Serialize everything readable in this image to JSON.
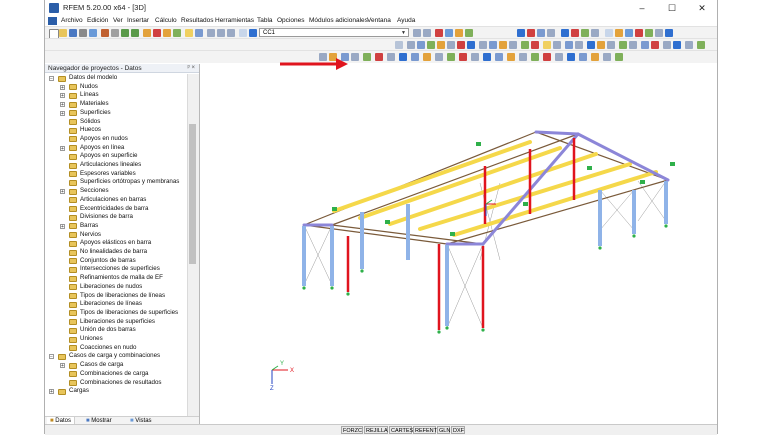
{
  "window": {
    "title": "RFEM 5.20.00 x64 - [3D]",
    "minimize": "–",
    "maximize": "☐",
    "close": "✕"
  },
  "menu": [
    "Archivo",
    "Edición",
    "Ver",
    "Insertar",
    "Cálculo",
    "Resultados",
    "Herramientas",
    "Tabla",
    "Opciones",
    "Módulos adicionales",
    "Ventana",
    "Ayuda"
  ],
  "toolbar": {
    "load_case": "CC1"
  },
  "navigator": {
    "title": "Navegador de proyectos - Datos",
    "pin": "ᵖ ×",
    "items": [
      {
        "label": "Datos del modelo",
        "level": 0,
        "expander": "−"
      },
      {
        "label": "Nudos",
        "level": 1,
        "expander": "+"
      },
      {
        "label": "Líneas",
        "level": 1,
        "expander": "+"
      },
      {
        "label": "Materiales",
        "level": 1,
        "expander": "+"
      },
      {
        "label": "Superficies",
        "level": 1,
        "expander": "+"
      },
      {
        "label": "Sólidos",
        "level": 1,
        "expander": ""
      },
      {
        "label": "Huecos",
        "level": 1,
        "expander": ""
      },
      {
        "label": "Apoyos en nudos",
        "level": 1,
        "expander": ""
      },
      {
        "label": "Apoyos en línea",
        "level": 1,
        "expander": "+"
      },
      {
        "label": "Apoyos en superficie",
        "level": 1,
        "expander": ""
      },
      {
        "label": "Articulaciones lineales",
        "level": 1,
        "expander": ""
      },
      {
        "label": "Espesores variables",
        "level": 1,
        "expander": ""
      },
      {
        "label": "Superficies ortótropas y membranas",
        "level": 1,
        "expander": ""
      },
      {
        "label": "Secciones",
        "level": 1,
        "expander": "+"
      },
      {
        "label": "Articulaciones en barras",
        "level": 1,
        "expander": ""
      },
      {
        "label": "Excentricidades de barra",
        "level": 1,
        "expander": ""
      },
      {
        "label": "Divisiones de barra",
        "level": 1,
        "expander": ""
      },
      {
        "label": "Barras",
        "level": 1,
        "expander": "+"
      },
      {
        "label": "Nervios",
        "level": 1,
        "expander": ""
      },
      {
        "label": "Apoyos elásticos en barra",
        "level": 1,
        "expander": ""
      },
      {
        "label": "No linealidades de barra",
        "level": 1,
        "expander": ""
      },
      {
        "label": "Conjuntos de barras",
        "level": 1,
        "expander": ""
      },
      {
        "label": "Intersecciones de superficies",
        "level": 1,
        "expander": ""
      },
      {
        "label": "Refinamientos de malla de EF",
        "level": 1,
        "expander": ""
      },
      {
        "label": "Liberaciones de nudos",
        "level": 1,
        "expander": ""
      },
      {
        "label": "Tipos de liberaciones de líneas",
        "level": 1,
        "expander": ""
      },
      {
        "label": "Liberaciones de líneas",
        "level": 1,
        "expander": ""
      },
      {
        "label": "Tipos de liberaciones de superficies",
        "level": 1,
        "expander": ""
      },
      {
        "label": "Liberaciones de superficies",
        "level": 1,
        "expander": ""
      },
      {
        "label": "Unión de dos barras",
        "level": 1,
        "expander": ""
      },
      {
        "label": "Uniones",
        "level": 1,
        "expander": ""
      },
      {
        "label": "Coacciones en nudo",
        "level": 1,
        "expander": ""
      },
      {
        "label": "Casos de carga y combinaciones",
        "level": 0,
        "expander": "−"
      },
      {
        "label": "Casos de carga",
        "level": 1,
        "expander": "+"
      },
      {
        "label": "Combinaciones de carga",
        "level": 1,
        "expander": ""
      },
      {
        "label": "Combinaciones de resultados",
        "level": 1,
        "expander": ""
      },
      {
        "label": "Cargas",
        "level": 0,
        "expander": "+"
      }
    ],
    "tabs": [
      "Datos",
      "Mostrar",
      "Vistas"
    ]
  },
  "axes": {
    "x": "X",
    "y": "Y",
    "z": "Z"
  },
  "status_buttons": [
    "FORZC",
    "REJILLA",
    "CARTES",
    "REFENT",
    "GLN",
    "DXF"
  ],
  "colors": {
    "column_blue": "#8fb3e8",
    "column_red": "#e0141e",
    "beam_yellow": "#f5d84a",
    "rafter_purple": "#8c86d8",
    "edge_brown": "#7a5a3a",
    "arrow_red": "#e0141e",
    "support_green": "#2fb04a"
  }
}
